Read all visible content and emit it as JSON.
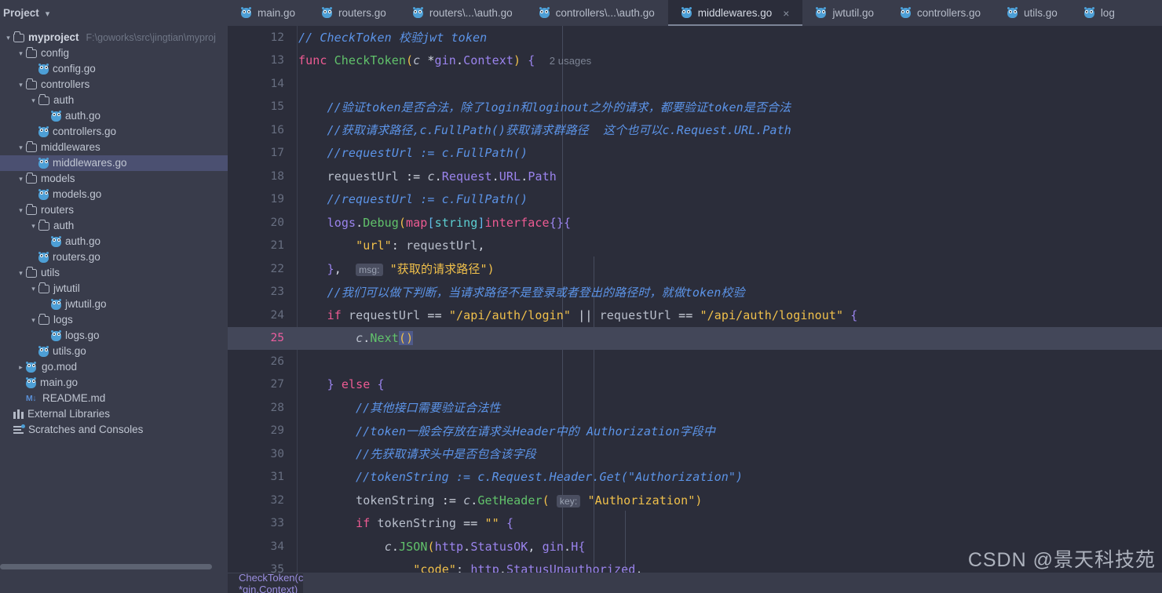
{
  "project_panel": {
    "title": "Project",
    "chevron": "chevron-down",
    "tree": [
      {
        "indent": 0,
        "arrow": "down",
        "icon": "folder",
        "label": "myproject",
        "bold": true,
        "path": "F:\\goworks\\src\\jingtian\\myproj"
      },
      {
        "indent": 1,
        "arrow": "down",
        "icon": "folder",
        "label": "config"
      },
      {
        "indent": 2,
        "arrow": "none",
        "icon": "go",
        "label": "config.go"
      },
      {
        "indent": 1,
        "arrow": "down",
        "icon": "folder",
        "label": "controllers"
      },
      {
        "indent": 2,
        "arrow": "down",
        "icon": "folder",
        "label": "auth"
      },
      {
        "indent": 3,
        "arrow": "none",
        "icon": "go",
        "label": "auth.go"
      },
      {
        "indent": 2,
        "arrow": "none",
        "icon": "go",
        "label": "controllers.go"
      },
      {
        "indent": 1,
        "arrow": "down",
        "icon": "folder",
        "label": "middlewares"
      },
      {
        "indent": 2,
        "arrow": "none",
        "icon": "go",
        "label": "middlewares.go",
        "selected": true
      },
      {
        "indent": 1,
        "arrow": "down",
        "icon": "folder",
        "label": "models"
      },
      {
        "indent": 2,
        "arrow": "none",
        "icon": "go",
        "label": "models.go"
      },
      {
        "indent": 1,
        "arrow": "down",
        "icon": "folder",
        "label": "routers"
      },
      {
        "indent": 2,
        "arrow": "down",
        "icon": "folder",
        "label": "auth"
      },
      {
        "indent": 3,
        "arrow": "none",
        "icon": "go",
        "label": "auth.go"
      },
      {
        "indent": 2,
        "arrow": "none",
        "icon": "go",
        "label": "routers.go"
      },
      {
        "indent": 1,
        "arrow": "down",
        "icon": "folder",
        "label": "utils"
      },
      {
        "indent": 2,
        "arrow": "down",
        "icon": "folder",
        "label": "jwtutil"
      },
      {
        "indent": 3,
        "arrow": "none",
        "icon": "go",
        "label": "jwtutil.go"
      },
      {
        "indent": 2,
        "arrow": "down",
        "icon": "folder",
        "label": "logs"
      },
      {
        "indent": 3,
        "arrow": "none",
        "icon": "go",
        "label": "logs.go"
      },
      {
        "indent": 2,
        "arrow": "none",
        "icon": "go",
        "label": "utils.go"
      },
      {
        "indent": 1,
        "arrow": "right",
        "icon": "gomod",
        "label": "go.mod"
      },
      {
        "indent": 1,
        "arrow": "none",
        "icon": "go",
        "label": "main.go"
      },
      {
        "indent": 1,
        "arrow": "none",
        "icon": "md",
        "label": "README.md"
      },
      {
        "indent": 0,
        "arrow": "none",
        "icon": "lib",
        "label": "External Libraries"
      },
      {
        "indent": 0,
        "arrow": "none",
        "icon": "scr",
        "label": "Scratches and Consoles"
      }
    ]
  },
  "tabs": [
    {
      "label": "main.go",
      "icon": "go-file-icon",
      "active": false
    },
    {
      "label": "routers.go",
      "icon": "go-file-icon",
      "active": false
    },
    {
      "label": "routers\\...\\auth.go",
      "icon": "go-file-icon",
      "active": false
    },
    {
      "label": "controllers\\...\\auth.go",
      "icon": "go-file-icon",
      "active": false
    },
    {
      "label": "middlewares.go",
      "icon": "go-file-icon",
      "active": true,
      "close": "×"
    },
    {
      "label": "jwtutil.go",
      "icon": "go-file-icon",
      "active": false
    },
    {
      "label": "controllers.go",
      "icon": "go-file-icon",
      "active": false
    },
    {
      "label": "utils.go",
      "icon": "go-file-icon",
      "active": false
    },
    {
      "label": "log",
      "icon": "go-file-icon",
      "active": false
    }
  ],
  "editor": {
    "first_line": 12,
    "current_line": 25,
    "usages_hint": "2 usages",
    "param_hint_msg": "msg:",
    "param_hint_key": "key:",
    "lines": [
      {
        "n": 12,
        "text": "// CheckToken 校验jwt token"
      },
      {
        "n": 13,
        "text": "func CheckToken(c *gin.Context) {  2 usages"
      },
      {
        "n": 14,
        "text": ""
      },
      {
        "n": 15,
        "text": "    //验证token是否合法，除了login和loginout之外的请求，都要验证token是否合法"
      },
      {
        "n": 16,
        "text": "    //获取请求路径,c.FullPath()获取请求群路径  这个也可以c.Request.URL.Path"
      },
      {
        "n": 17,
        "text": "    //requestUrl := c.FullPath()"
      },
      {
        "n": 18,
        "text": "    requestUrl := c.Request.URL.Path"
      },
      {
        "n": 19,
        "text": "    //requestUrl := c.FullPath()"
      },
      {
        "n": 20,
        "text": "    logs.Debug(map[string]interface{}{"
      },
      {
        "n": 21,
        "text": "        \"url\": requestUrl,"
      },
      {
        "n": 22,
        "text": "    },  msg: \"获取的请求路径\")"
      },
      {
        "n": 23,
        "text": "    //我们可以做下判断，当请求路径不是登录或者登出的路径时，就做token校验"
      },
      {
        "n": 24,
        "text": "    if requestUrl == \"/api/auth/login\" || requestUrl == \"/api/auth/loginout\" {"
      },
      {
        "n": 25,
        "text": "        c.Next()"
      },
      {
        "n": 26,
        "text": ""
      },
      {
        "n": 27,
        "text": "    } else {"
      },
      {
        "n": 28,
        "text": "        //其他接口需要验证合法性"
      },
      {
        "n": 29,
        "text": "        //token一般会存放在请求头Header中的 Authorization字段中"
      },
      {
        "n": 30,
        "text": "        //先获取请求头中是否包含该字段"
      },
      {
        "n": 31,
        "text": "        //tokenString := c.Request.Header.Get(\"Authorization\")"
      },
      {
        "n": 32,
        "text": "        tokenString := c.GetHeader( key: \"Authorization\")"
      },
      {
        "n": 33,
        "text": "        if tokenString == \"\" {"
      },
      {
        "n": 34,
        "text": "            c.JSON(http.StatusOK, gin.H{"
      },
      {
        "n": 35,
        "text": "                \"code\": http.StatusUnauthorized,"
      }
    ]
  },
  "breadcrumb": {
    "text": "CheckToken(c *gin.Context)"
  },
  "watermark": {
    "text": "CSDN @景天科技苑"
  },
  "colors": {
    "editor_bg": "#2b2d3a",
    "panel_bg": "#393c4b",
    "current_line_bg": "#434759",
    "selection_bg": "#4f5a8a",
    "tree_selected_bg": "#4b5071",
    "keyword": "#ee5b93",
    "function": "#61c26b",
    "type": "#9b84ee",
    "string": "#f0c04b",
    "comment": "#5c94e8",
    "property": "#62b8ec",
    "breadcrumb_text": "#9b8fe0"
  }
}
